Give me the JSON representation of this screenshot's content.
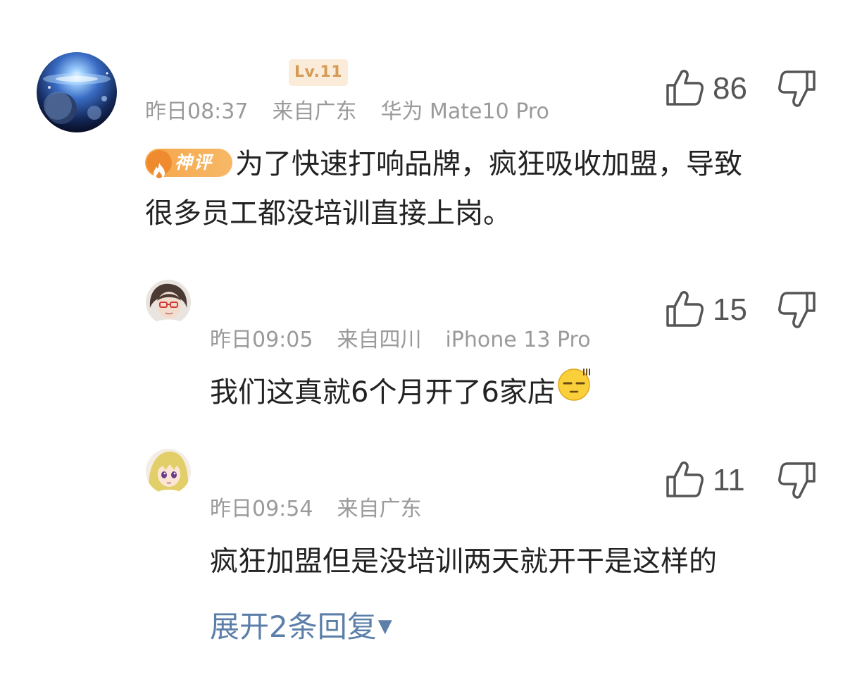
{
  "comments": [
    {
      "level": "Lv.11",
      "time": "昨日08:37",
      "location": "来自广东",
      "device": "华为 Mate10 Pro",
      "badge": "神评",
      "line1": "为了快速打响品牌，疯狂吸收加盟，导致",
      "line2": "很多员工都没培训直接上岗。",
      "likes": "86"
    },
    {
      "time": "昨日09:05",
      "location": "来自四川",
      "device": "iPhone 13 Pro",
      "text": "我们这真就6个月开了6家店",
      "emoji": "speechless-face",
      "likes": "15"
    },
    {
      "time": "昨日09:54",
      "location": "来自广东",
      "text": "疯狂加盟但是没培训两天就开干是这样的",
      "likes": "11"
    }
  ],
  "expand": {
    "label": "展开2条回复",
    "arrow": "▼"
  },
  "colors": {
    "link": "#5c7fa9",
    "meta": "#9a9a9a",
    "badge_bg": "#fbecd9",
    "badge_text": "#d59a55",
    "hot_badge": "#f4a64a"
  }
}
